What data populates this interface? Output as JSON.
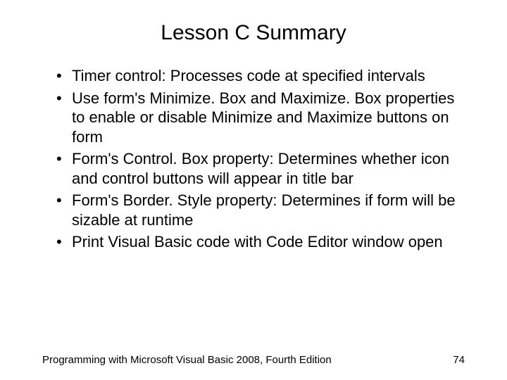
{
  "title": "Lesson C Summary",
  "bullets": [
    "Timer control: Processes code at specified intervals",
    "Use form's Minimize. Box and Maximize. Box properties to enable or disable Minimize and Maximize buttons on form",
    "Form's Control. Box property: Determines whether icon and control buttons will appear in title bar",
    "Form's Border. Style property: Determines if form will be sizable at runtime",
    "Print Visual Basic code with Code Editor window open"
  ],
  "footer_left": "Programming with Microsoft Visual Basic 2008, Fourth Edition",
  "footer_right": "74"
}
